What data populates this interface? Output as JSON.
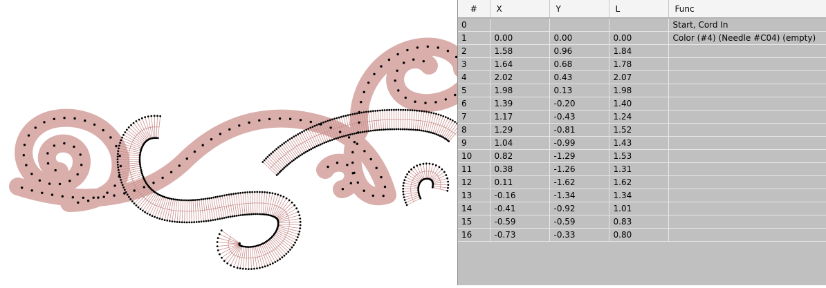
{
  "design": {
    "stitch_color": "#d9aeab",
    "needle_point_color": "#000000",
    "radial_line_color": "#c98f8d"
  },
  "stitch_table": {
    "columns": [
      "#",
      "X",
      "Y",
      "L",
      "Func"
    ],
    "rows": [
      {
        "n": "0",
        "x": "",
        "y": "",
        "l": "",
        "func": "Start, Cord In"
      },
      {
        "n": "1",
        "x": "0.00",
        "y": "0.00",
        "l": "0.00",
        "func": "Color (#4) (Needle #C04) (empty)"
      },
      {
        "n": "2",
        "x": "1.58",
        "y": "0.96",
        "l": "1.84",
        "func": ""
      },
      {
        "n": "3",
        "x": "1.64",
        "y": "0.68",
        "l": "1.78",
        "func": ""
      },
      {
        "n": "4",
        "x": "2.02",
        "y": "0.43",
        "l": "2.07",
        "func": ""
      },
      {
        "n": "5",
        "x": "1.98",
        "y": "0.13",
        "l": "1.98",
        "func": ""
      },
      {
        "n": "6",
        "x": "1.39",
        "y": "-0.20",
        "l": "1.40",
        "func": ""
      },
      {
        "n": "7",
        "x": "1.17",
        "y": "-0.43",
        "l": "1.24",
        "func": ""
      },
      {
        "n": "8",
        "x": "1.29",
        "y": "-0.81",
        "l": "1.52",
        "func": ""
      },
      {
        "n": "9",
        "x": "1.04",
        "y": "-0.99",
        "l": "1.43",
        "func": ""
      },
      {
        "n": "10",
        "x": "0.82",
        "y": "-1.29",
        "l": "1.53",
        "func": ""
      },
      {
        "n": "11",
        "x": "0.38",
        "y": "-1.26",
        "l": "1.31",
        "func": ""
      },
      {
        "n": "12",
        "x": "0.11",
        "y": "-1.62",
        "l": "1.62",
        "func": ""
      },
      {
        "n": "13",
        "x": "-0.16",
        "y": "-1.34",
        "l": "1.34",
        "func": ""
      },
      {
        "n": "14",
        "x": "-0.41",
        "y": "-0.92",
        "l": "1.01",
        "func": ""
      },
      {
        "n": "15",
        "x": "-0.59",
        "y": "-0.59",
        "l": "0.83",
        "func": ""
      },
      {
        "n": "16",
        "x": "-0.73",
        "y": "-0.33",
        "l": "0.80",
        "func": ""
      }
    ]
  }
}
